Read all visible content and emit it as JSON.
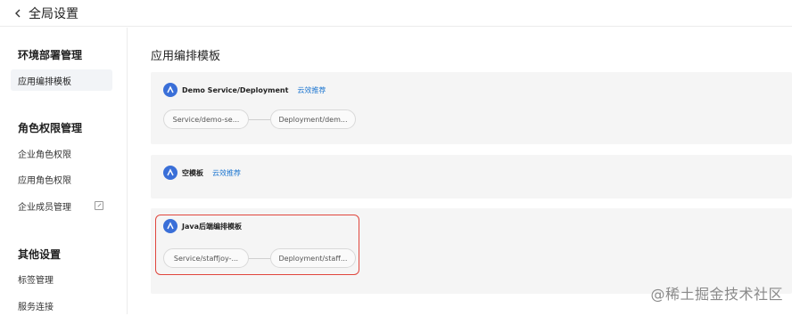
{
  "header": {
    "title": "全局设置"
  },
  "sidebar": {
    "groups": [
      {
        "title": "环境部署管理",
        "items": [
          {
            "label": "应用编排模板",
            "active": true
          }
        ]
      },
      {
        "title": "角色权限管理",
        "items": [
          {
            "label": "企业角色权限"
          },
          {
            "label": "应用角色权限"
          },
          {
            "label": "企业成员管理",
            "external": true
          }
        ]
      },
      {
        "title": "其他设置",
        "items": [
          {
            "label": "标签管理"
          },
          {
            "label": "服务连接"
          }
        ]
      }
    ]
  },
  "main": {
    "title": "应用编排模板",
    "templates": [
      {
        "name": "Demo Service/Deployment",
        "link": "云效推荐",
        "nodes": [
          "Service/demo-se...",
          "Deployment/dem..."
        ]
      },
      {
        "name": "空模板",
        "link": "云效推荐",
        "nodes": []
      },
      {
        "name": "Java后端编排模板",
        "link": "",
        "nodes": [
          "Service/staffjoy-...",
          "Deployment/staff..."
        ]
      }
    ]
  },
  "watermark": "@稀土掘金技术社区",
  "colors": {
    "accent": "#1b75d0",
    "logo": "#3a6fd8",
    "highlight": "#e0463d",
    "card_bg": "#f5f5f5"
  }
}
